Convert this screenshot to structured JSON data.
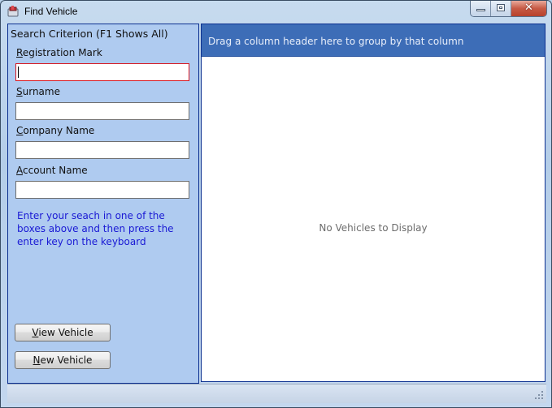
{
  "window": {
    "title": "Find Vehicle",
    "controls": {
      "minimize": "minimize",
      "maximize": "maximize",
      "close": "✕"
    }
  },
  "search_panel": {
    "header": "Search Criterion (F1 Shows All)",
    "fields": [
      {
        "label_access": "R",
        "label_rest": "egistration Mark",
        "value": "",
        "focused": true
      },
      {
        "label_access": "S",
        "label_rest": "urname",
        "value": ""
      },
      {
        "label_access": "C",
        "label_rest": "ompany Name",
        "value": ""
      },
      {
        "label_access": "A",
        "label_rest": "ccount Name",
        "value": ""
      }
    ],
    "hint": "Enter your seach in one of the boxes above and then press the enter key on the keyboard",
    "buttons": {
      "view": {
        "access": "V",
        "rest": "iew Vehicle"
      },
      "new": {
        "access": "N",
        "rest": "ew Vehicle"
      }
    }
  },
  "grid": {
    "group_by_hint": "Drag a column header here to group by that column",
    "empty_text": "No Vehicles to Display"
  },
  "colors": {
    "panel_bg": "#afcbf0",
    "panel_border": "#0c3090",
    "group_header_bg": "#3d6db7",
    "hint_text": "#1a19d4",
    "focused_border": "#d8161e"
  }
}
